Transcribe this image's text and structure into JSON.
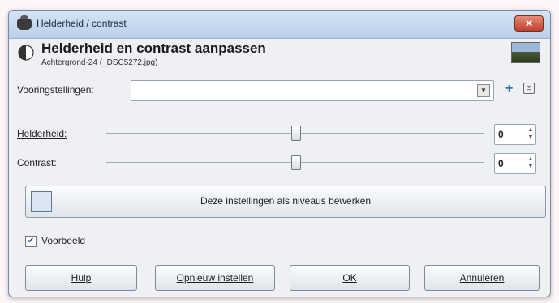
{
  "window": {
    "title": "Helderheid / contrast",
    "close_glyph": "✕"
  },
  "header": {
    "title": "Helderheid en contrast aanpassen",
    "subtitle": "Achtergrond-24 (_DSC5272.jpg)"
  },
  "presets": {
    "label": "Vooringstellingen:",
    "value": "",
    "plus_icon": "+",
    "menu_icon": "⊡"
  },
  "brightness": {
    "label": "Helderheid:",
    "value": "0",
    "level": 0.5
  },
  "contrast": {
    "label": "Contrast:",
    "value": "0",
    "level": 0.5
  },
  "levels_button": {
    "label": "Deze instellingen als niveaus bewerken"
  },
  "preview": {
    "label": "Voorbeeld",
    "checked": true
  },
  "buttons": {
    "help": "Hulp",
    "reset": "Opnieuw instellen",
    "ok": "OK",
    "cancel": "Annuleren"
  }
}
